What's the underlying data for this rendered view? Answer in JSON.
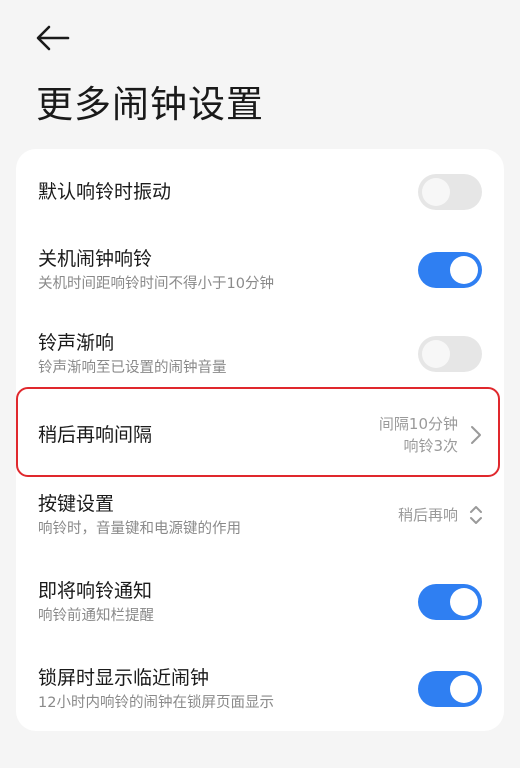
{
  "header": {
    "back_icon": "arrow-left-icon",
    "title": "更多闹钟设置"
  },
  "settings": [
    {
      "id": "vibrate",
      "title": "默认响铃时振动",
      "subtitle": "",
      "control": "toggle",
      "on": false
    },
    {
      "id": "power-off-alarm",
      "title": "关机闹钟响铃",
      "subtitle": "关机时间距响铃时间不得小于10分钟",
      "control": "toggle",
      "on": true
    },
    {
      "id": "fade-in",
      "title": "铃声渐响",
      "subtitle": "铃声渐响至已设置的闹钟音量",
      "control": "toggle",
      "on": false
    },
    {
      "id": "snooze-interval",
      "title": "稍后再响间隔",
      "subtitle": "",
      "control": "link",
      "value_line1": "间隔10分钟",
      "value_line2": "响铃3次",
      "icon": "chevron-right-icon"
    },
    {
      "id": "button-settings",
      "title": "按键设置",
      "subtitle": "响铃时，音量键和电源键的作用",
      "control": "select",
      "value_line1": "稍后再响",
      "icon": "chevron-up-down-icon"
    },
    {
      "id": "upcoming-notify",
      "title": "即将响铃通知",
      "subtitle": "响铃前通知栏提醒",
      "control": "toggle",
      "on": true
    },
    {
      "id": "lockscreen-show",
      "title": "锁屏时显示临近闹钟",
      "subtitle": "12小时内响铃的闹钟在锁屏页面显示",
      "control": "toggle",
      "on": true
    }
  ],
  "colors": {
    "accent": "#2f7ff2",
    "toggle_off": "#e6e6e6",
    "highlight": "#e0282d",
    "background": "#f5f5f5",
    "card": "#ffffff"
  }
}
